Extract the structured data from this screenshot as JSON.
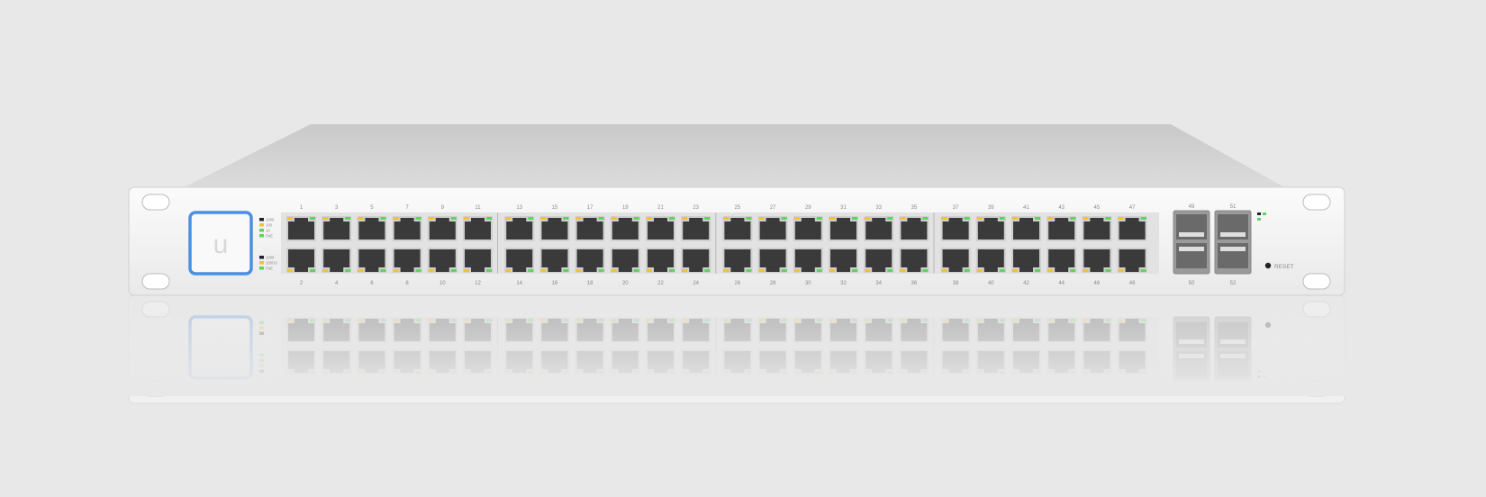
{
  "device": {
    "logo_letter": "u",
    "top_port_numbers": [
      "1",
      "3",
      "5",
      "7",
      "9",
      "11",
      "13",
      "15",
      "17",
      "19",
      "21",
      "23",
      "25",
      "27",
      "29",
      "31",
      "33",
      "35",
      "37",
      "39",
      "41",
      "43",
      "45",
      "47"
    ],
    "bottom_port_numbers": [
      "2",
      "4",
      "6",
      "8",
      "10",
      "12",
      "14",
      "16",
      "18",
      "20",
      "22",
      "24",
      "26",
      "28",
      "30",
      "32",
      "34",
      "36",
      "38",
      "40",
      "42",
      "44",
      "46",
      "48"
    ],
    "sfp_top_labels": [
      "49",
      "51"
    ],
    "sfp_bottom_labels": [
      "50",
      "52"
    ],
    "reset_label": "RESET",
    "led_legend_top": [
      "1000",
      "100",
      "10",
      "PoE"
    ],
    "led_legend_bottom": [
      "1000",
      "100/10",
      "PoE"
    ],
    "colors": {
      "background": "#e8e8e8",
      "chassis": "#f2f2f2",
      "logo_ring": "#4a90e2",
      "led_green": "#5fd35f",
      "led_amber": "#f2c230",
      "port": "#3a3a3a"
    }
  }
}
